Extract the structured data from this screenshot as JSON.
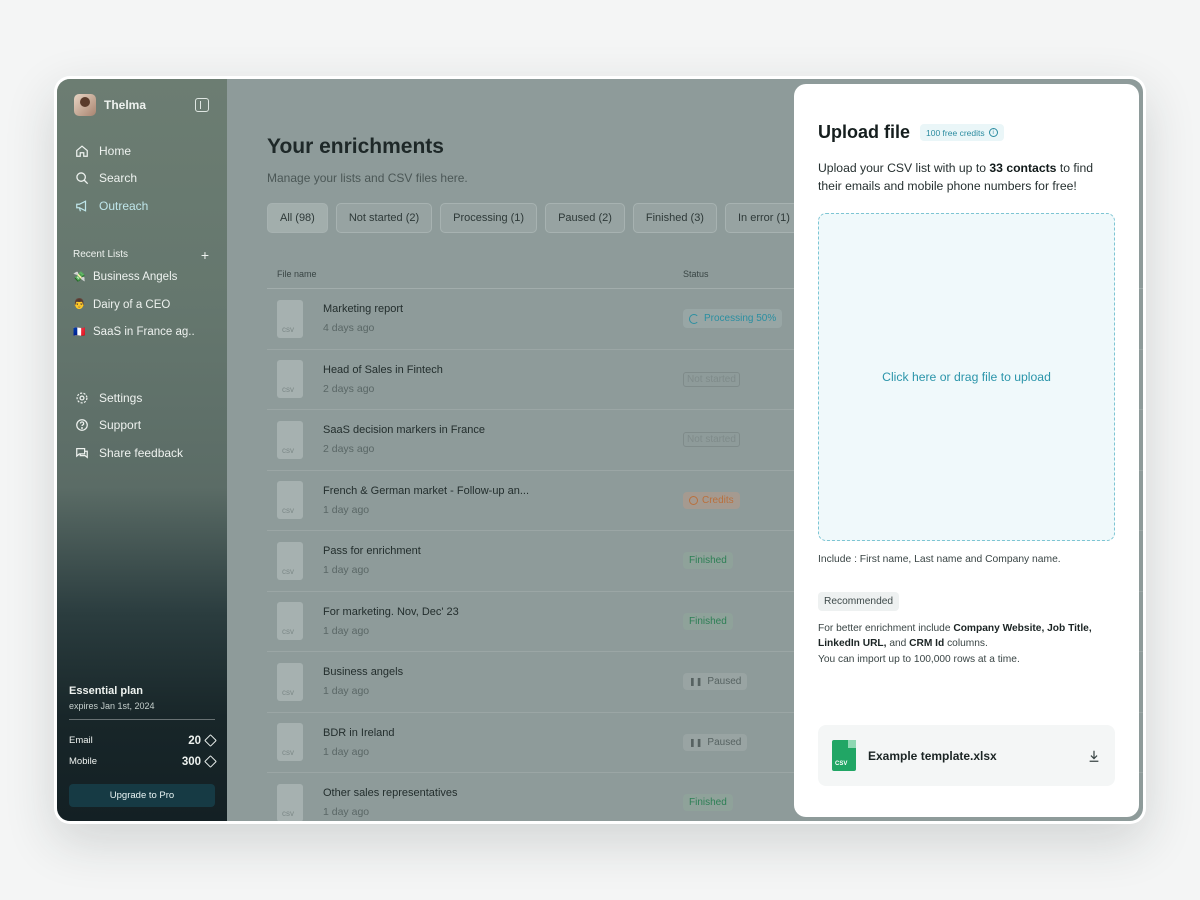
{
  "sidebar": {
    "user_name": "Thelma",
    "nav": [
      {
        "label": "Home",
        "icon": "home-icon"
      },
      {
        "label": "Search",
        "icon": "search-icon"
      },
      {
        "label": "Outreach",
        "icon": "megaphone-icon"
      }
    ],
    "recent_title": "Recent Lists",
    "recent": [
      {
        "emoji": "💸",
        "label": "Business Angels"
      },
      {
        "emoji": "👨",
        "label": "Dairy of a CEO"
      },
      {
        "emoji": "🇫🇷",
        "label": "SaaS in France ag.."
      }
    ],
    "nav2": [
      {
        "label": "Settings",
        "icon": "gear-icon"
      },
      {
        "label": "Support",
        "icon": "help-icon"
      },
      {
        "label": "Share feedback",
        "icon": "chat-icon"
      }
    ],
    "plan": {
      "title": "Essential plan",
      "expires": "expires Jan 1st, 2024",
      "email_label": "Email",
      "email_value": "20",
      "mobile_label": "Mobile",
      "mobile_value": "300",
      "upgrade": "Upgrade to Pro"
    }
  },
  "main": {
    "title": "Your enrichments",
    "subtitle": "Manage your lists and CSV files here.",
    "filters": [
      "All (98)",
      "Not started (2)",
      "Processing (1)",
      "Paused (2)",
      "Finished (3)",
      "In error (1)"
    ],
    "columns": {
      "file": "File name",
      "status": "Status"
    },
    "rows": [
      {
        "name": "Marketing report",
        "date": "4 days ago",
        "status": "Processing 50%",
        "kind": "processing"
      },
      {
        "name": "Head of Sales in Fintech",
        "date": "2 days ago",
        "status": "Not started",
        "kind": "notstarted"
      },
      {
        "name": "SaaS decision markers in France",
        "date": "2 days ago",
        "status": "Not started",
        "kind": "notstarted"
      },
      {
        "name": "French & German market - Follow-up an...",
        "date": "1 day ago",
        "status": "Credits",
        "kind": "credits"
      },
      {
        "name": "Pass for enrichment",
        "date": "1 day ago",
        "status": "Finished",
        "kind": "finished"
      },
      {
        "name": "For marketing. Nov, Dec' 23",
        "date": "1 day ago",
        "status": "Finished",
        "kind": "finished"
      },
      {
        "name": "Business angels",
        "date": "1 day ago",
        "status": "Paused",
        "kind": "paused"
      },
      {
        "name": "BDR in Ireland",
        "date": "1 day ago",
        "status": "Paused",
        "kind": "paused"
      },
      {
        "name": "Other sales representatives",
        "date": "1 day ago",
        "status": "Finished",
        "kind": "finished"
      }
    ],
    "file_type": "csv"
  },
  "modal": {
    "title": "Upload file",
    "badge": "100 free credits",
    "desc_pre": "Upload your CSV list with up to ",
    "desc_bold": "33 contacts",
    "desc_post": " to find their emails and mobile phone numbers for free!",
    "dropzone": "Click here or drag file to upload",
    "include": "Include : First name, Last name and Company name.",
    "recommended": "Recommended",
    "rec_pre": "For better enrichment include ",
    "rec_bold1": "Company Website, Job Title, LinkedIn URL,",
    "rec_mid": " and ",
    "rec_bold2": "CRM Id",
    "rec_post": " columns.",
    "rec_rows": "You can import up to 100,000 rows at a time.",
    "template_name": "Example template.xlsx",
    "template_type": "CSV"
  }
}
